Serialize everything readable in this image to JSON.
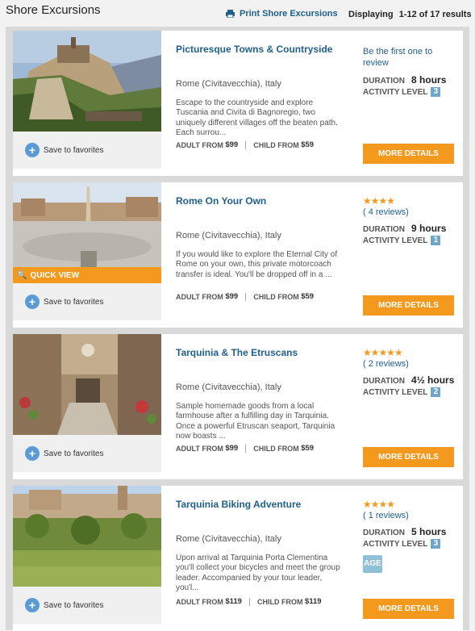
{
  "header": {
    "title": "Shore Excursions",
    "print_label": "Print Shore Excursions",
    "display_label": "Displaying",
    "display_range": "1-12",
    "display_of": "of 17 results"
  },
  "common": {
    "save_label": "Save to favorites",
    "adult_label": "ADULT FROM",
    "child_label": "CHILD FROM",
    "duration_label": "DURATION",
    "activity_label": "ACTIVITY LEVEL",
    "more_label": "MORE DETAILS",
    "quick_view_label": "QUICK VIEW",
    "age_label": "AGE"
  },
  "excursions": [
    {
      "title": "Picturesque Towns & Countryside",
      "location": "Rome (Civitavecchia), Italy",
      "description": "Escape to the countryside and explore Tuscania and Civita di Bagnoregio, two uniquely different villages off the beaten path. Each surrou...",
      "adult_price": "$99",
      "child_price": "$59",
      "review_text": "Be the first one to review",
      "stars": "",
      "reviews": "",
      "duration": "8 hours",
      "activity_level": "3"
    },
    {
      "title": "Rome On Your Own",
      "location": "Rome (Civitavecchia), Italy",
      "description": "If you would like to explore the Eternal City of Rome on your own, this private motorcoach transfer is ideal. You'll be dropped off in a ...",
      "adult_price": "$99",
      "child_price": "$59",
      "review_text": "",
      "stars": "★★★★",
      "reviews": "( 4 reviews)",
      "duration": "9 hours",
      "activity_level": "1"
    },
    {
      "title": "Tarquinia & The Etruscans",
      "location": "Rome (Civitavecchia), Italy",
      "description": "Sample homemade goods from a local farmhouse after a fulfilling day in Tarquinia. Once a powerful Etruscan seaport, Tarquinia now boasts ...",
      "adult_price": "$99",
      "child_price": "$59",
      "review_text": "",
      "stars": "★★★★★",
      "reviews": "( 2 reviews)",
      "duration": "4½ hours",
      "activity_level": "2"
    },
    {
      "title": "Tarquinia Biking Adventure",
      "location": "Rome (Civitavecchia), Italy",
      "description": "Upon arrival at Tarquinia Porta Clementina you'll collect your bicycles and meet the group leader. Accompanied by your tour leader, you'l...",
      "adult_price": "$119",
      "child_price": "$119",
      "review_text": "",
      "stars": "★★★★",
      "reviews": "( 1 reviews)",
      "duration": "5 hours",
      "activity_level": "3"
    }
  ],
  "colors": {
    "accent": "#f39a1e",
    "link": "#1f5f8b",
    "level_badge": "#6fa6c9"
  }
}
